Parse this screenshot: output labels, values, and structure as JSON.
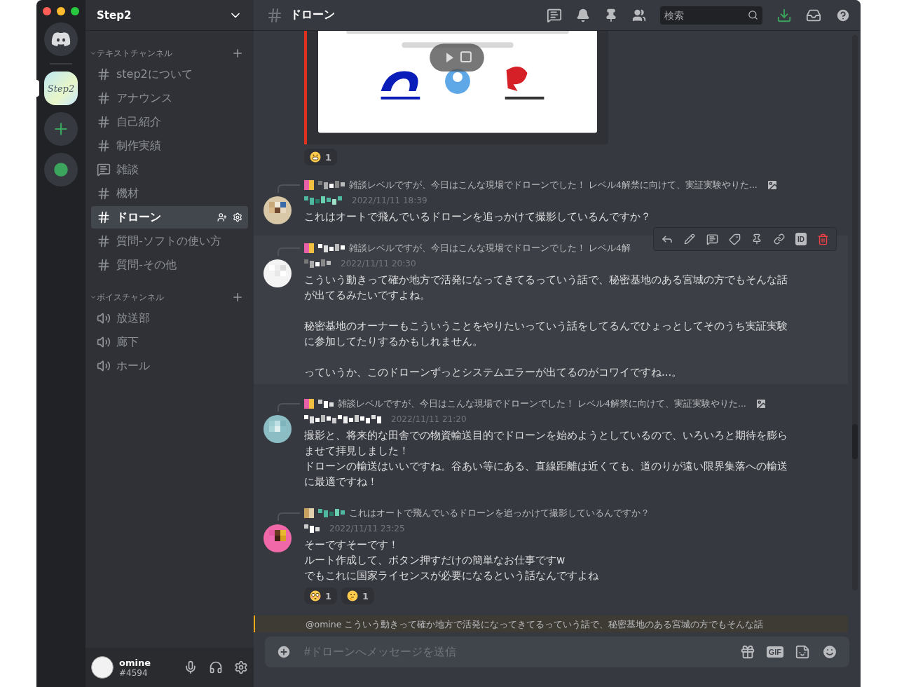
{
  "server_rail": {
    "servers": [
      {
        "kind": "home",
        "selected": false
      },
      {
        "kind": "server",
        "label": "Step2",
        "selected": true
      },
      {
        "kind": "add",
        "selected": false
      },
      {
        "kind": "explore",
        "selected": false
      }
    ]
  },
  "sidebar": {
    "server_name": "Step2",
    "categories": [
      {
        "name": "テキストチャンネル",
        "channels": [
          {
            "name": "step2について",
            "kind": "text",
            "selected": false
          },
          {
            "name": "アナウンス",
            "kind": "text",
            "selected": false
          },
          {
            "name": "自己紹介",
            "kind": "text",
            "selected": false
          },
          {
            "name": "制作実績",
            "kind": "text",
            "selected": false
          },
          {
            "name": "雑談",
            "kind": "thread",
            "selected": false
          },
          {
            "name": "機材",
            "kind": "text",
            "selected": false
          },
          {
            "name": "ドローン",
            "kind": "text",
            "selected": true
          },
          {
            "name": "質問-ソフトの使い方",
            "kind": "text",
            "selected": false
          },
          {
            "name": "質問-その他",
            "kind": "text",
            "selected": false
          }
        ]
      },
      {
        "name": "ボイスチャンネル",
        "channels": [
          {
            "name": "放送部",
            "kind": "voice",
            "selected": false
          },
          {
            "name": "廊下",
            "kind": "voice",
            "selected": false
          },
          {
            "name": "ホール",
            "kind": "voice",
            "selected": false
          }
        ]
      }
    ]
  },
  "user_panel": {
    "name": "omine",
    "tag": "#4594"
  },
  "header": {
    "channel": "ドローン",
    "search_placeholder": "検索"
  },
  "messages": [
    {
      "kind": "embed",
      "reactions": [
        {
          "kind": "grin",
          "count": "1"
        }
      ]
    },
    {
      "kind": "message",
      "hovered": false,
      "reply": {
        "text": "雑談レベルですが、今日はこんな現場でドローンでした！ レベル4解禁に向けて、実証実験やりた...",
        "has_image": true
      },
      "timestamp": "2022/11/11 18:39",
      "paragraphs": [
        [
          "これはオートで飛んでいるドローンを追っかけて撮影しているんですか？"
        ]
      ]
    },
    {
      "kind": "message",
      "hovered": true,
      "reply": {
        "text": "雑談レベルですが、今日はこんな現場でドローンでした！ レベル4解",
        "has_image": false
      },
      "timestamp": "2022/11/11 20:30",
      "paragraphs": [
        [
          "こういう動きって確か地方で活発になってきてるっていう話で、秘密基地のある宮城の方でもそんな話が出てるみたいですよね。"
        ],
        [
          "秘密基地のオーナーもこういうことをやりたいっていう話をしてるんでひょっとしてそのうち実証実験に参加してたりするかもしれません。"
        ],
        [
          "っていうか、このドローンずっとシステムエラーが出てるのがコワイですね...。"
        ]
      ]
    },
    {
      "kind": "message",
      "hovered": false,
      "reply": {
        "text": "雑談レベルですが、今日はこんな現場でドローンでした！ レベル4解禁に向けて、実証実験やりた...",
        "has_image": true
      },
      "timestamp": "2022/11/11 21:20",
      "paragraphs": [
        [
          "撮影と、将来的な田舎での物資輸送目的でドローンを始めようとしているので、いろいろと期待を膨らませて拝見しました！",
          "ドローンの輸送はいいですね。谷あい等にある、直線距離は近くても、道のりが遠い限界集落への輸送に最適ですね！"
        ]
      ]
    },
    {
      "kind": "message",
      "hovered": false,
      "reply": {
        "text": "これはオートで飛んでいるドローンを追っかけて撮影しているんですか？",
        "has_image": false
      },
      "timestamp": "2022/11/11 23:25",
      "paragraphs": [
        [
          "そーですそーです！",
          "ルート作成して、ボタン押すだけの簡単なお仕事ですw",
          "でもこれに国家ライセンスが必要になるという話なんですよね"
        ]
      ],
      "reactions": [
        {
          "kind": "flushed",
          "count": "1"
        },
        {
          "kind": "thinking",
          "count": "1"
        }
      ]
    },
    {
      "kind": "mention",
      "text": "@omine こういう動きって確か地方で活発になってきてるっていう話で、秘密基地のある宮城の方でもそんな話"
    }
  ],
  "message_toolbar": {
    "id_label": "ID"
  },
  "composer": {
    "placeholder": "#ドローンへメッセージを送信",
    "gif_label": "GIF"
  }
}
